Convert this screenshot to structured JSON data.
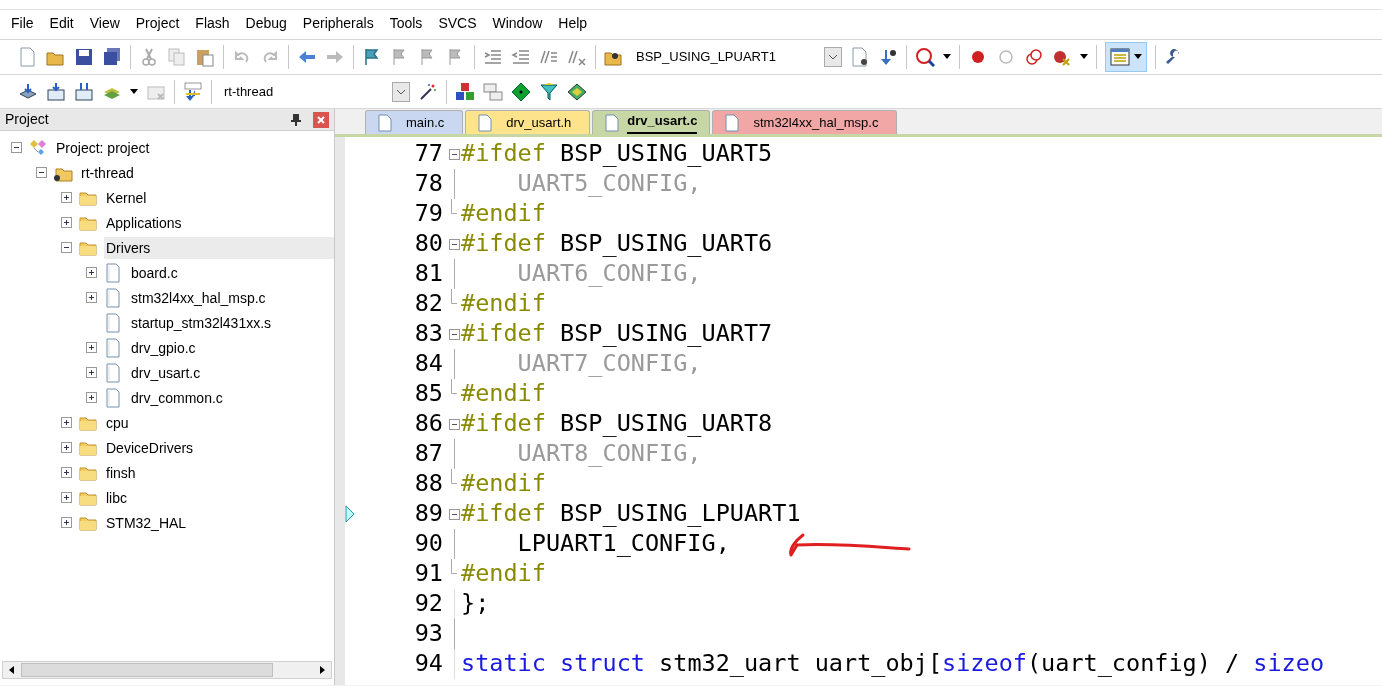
{
  "menu": [
    "File",
    "Edit",
    "View",
    "Project",
    "Flash",
    "Debug",
    "Peripherals",
    "Tools",
    "SVCS",
    "Window",
    "Help"
  ],
  "toolbar": {
    "define_combo": "BSP_USING_LPUART1",
    "layout_button_on": true
  },
  "build_toolbar": {
    "target_combo": "rt-thread"
  },
  "project_panel": {
    "title": "Project",
    "tree": [
      {
        "label": "Project: project",
        "kind": "project",
        "expanded": true,
        "selected": false,
        "children": [
          {
            "label": "rt-thread",
            "kind": "target",
            "expanded": true,
            "selected": false,
            "children": [
              {
                "label": "Kernel",
                "kind": "folder",
                "expanded": false,
                "selected": false
              },
              {
                "label": "Applications",
                "kind": "folder",
                "expanded": false,
                "selected": false
              },
              {
                "label": "Drivers",
                "kind": "folder",
                "expanded": true,
                "selected": true,
                "children": [
                  {
                    "label": "board.c",
                    "kind": "file",
                    "expandable": true,
                    "selected": false
                  },
                  {
                    "label": "stm32l4xx_hal_msp.c",
                    "kind": "file",
                    "expandable": true,
                    "selected": false
                  },
                  {
                    "label": "startup_stm32l431xx.s",
                    "kind": "file",
                    "expandable": false,
                    "selected": false
                  },
                  {
                    "label": "drv_gpio.c",
                    "kind": "file",
                    "expandable": true,
                    "selected": false
                  },
                  {
                    "label": "drv_usart.c",
                    "kind": "file",
                    "expandable": true,
                    "selected": false
                  },
                  {
                    "label": "drv_common.c",
                    "kind": "file",
                    "expandable": true,
                    "selected": false
                  }
                ]
              },
              {
                "label": "cpu",
                "kind": "folder",
                "expanded": false,
                "selected": false
              },
              {
                "label": "DeviceDrivers",
                "kind": "folder",
                "expanded": false,
                "selected": false
              },
              {
                "label": "finsh",
                "kind": "folder",
                "expanded": false,
                "selected": false
              },
              {
                "label": "libc",
                "kind": "folder",
                "expanded": false,
                "selected": false
              },
              {
                "label": "STM32_HAL",
                "kind": "folder",
                "expanded": false,
                "selected": false
              }
            ]
          }
        ]
      }
    ]
  },
  "tabs": [
    {
      "label": "main.c",
      "color": "#c9d8f0",
      "selected": false
    },
    {
      "label": "drv_usart.h",
      "color": "#fde48c",
      "selected": false
    },
    {
      "label": "drv_usart.c",
      "color": "#c6d6a4",
      "selected": true
    },
    {
      "label": "stm32l4xx_hal_msp.c",
      "color": "#f2a7a7",
      "selected": false
    }
  ],
  "editor": {
    "lines": [
      {
        "number": "77",
        "kind": "fold_start",
        "current": false,
        "tokens": [
          {
            "text": "#ifdef",
            "kind": "preproc"
          },
          {
            "text": " BSP_USING_UART5",
            "kind": "plain"
          }
        ]
      },
      {
        "number": "78",
        "kind": "fold_body",
        "current": false,
        "tokens": [
          {
            "text": "    UART5_CONFIG,",
            "kind": "inactive"
          }
        ]
      },
      {
        "number": "79",
        "kind": "fold_end",
        "current": false,
        "tokens": [
          {
            "text": "#endif",
            "kind": "preproc"
          }
        ]
      },
      {
        "number": "80",
        "kind": "fold_start",
        "current": false,
        "tokens": [
          {
            "text": "#ifdef",
            "kind": "preproc"
          },
          {
            "text": " BSP_USING_UART6",
            "kind": "plain"
          }
        ]
      },
      {
        "number": "81",
        "kind": "fold_body",
        "current": false,
        "tokens": [
          {
            "text": "    UART6_CONFIG,",
            "kind": "inactive"
          }
        ]
      },
      {
        "number": "82",
        "kind": "fold_end",
        "current": false,
        "tokens": [
          {
            "text": "#endif",
            "kind": "preproc"
          }
        ]
      },
      {
        "number": "83",
        "kind": "fold_start",
        "current": false,
        "tokens": [
          {
            "text": "#ifdef",
            "kind": "preproc"
          },
          {
            "text": " BSP_USING_UART7",
            "kind": "plain"
          }
        ]
      },
      {
        "number": "84",
        "kind": "fold_body",
        "current": false,
        "tokens": [
          {
            "text": "    UART7_CONFIG,",
            "kind": "inactive"
          }
        ]
      },
      {
        "number": "85",
        "kind": "fold_end",
        "current": false,
        "tokens": [
          {
            "text": "#endif",
            "kind": "preproc"
          }
        ]
      },
      {
        "number": "86",
        "kind": "fold_start",
        "current": false,
        "tokens": [
          {
            "text": "#ifdef",
            "kind": "preproc"
          },
          {
            "text": " BSP_USING_UART8",
            "kind": "plain"
          }
        ]
      },
      {
        "number": "87",
        "kind": "fold_body",
        "current": false,
        "tokens": [
          {
            "text": "    UART8_CONFIG,",
            "kind": "inactive"
          }
        ]
      },
      {
        "number": "88",
        "kind": "fold_end",
        "current": false,
        "tokens": [
          {
            "text": "#endif",
            "kind": "preproc"
          }
        ]
      },
      {
        "number": "89",
        "kind": "fold_start",
        "current": true,
        "tokens": [
          {
            "text": "#ifdef",
            "kind": "preproc"
          },
          {
            "text": " BSP_USING_LPUART1",
            "kind": "plain"
          }
        ]
      },
      {
        "number": "90",
        "kind": "fold_body",
        "current": false,
        "tokens": [
          {
            "text": "    LPUART1_CONFIG,",
            "kind": "plain"
          }
        ]
      },
      {
        "number": "91",
        "kind": "fold_end",
        "current": false,
        "tokens": [
          {
            "text": "#endif",
            "kind": "preproc"
          }
        ]
      },
      {
        "number": "92",
        "kind": "plain",
        "current": false,
        "tokens": [
          {
            "text": "};",
            "kind": "plain"
          }
        ]
      },
      {
        "number": "93",
        "kind": "fold_body",
        "current": false
      },
      {
        "number": "94",
        "kind": "plain",
        "current": false,
        "tokens": [
          {
            "text": "static",
            "kind": "keyword"
          },
          {
            "text": " struct",
            "kind": "keyword"
          },
          {
            "text": " stm32_uart uart_obj[",
            "kind": "plain"
          },
          {
            "text": "sizeof",
            "kind": "keyword"
          },
          {
            "text": "(uart_config) / ",
            "kind": "plain"
          },
          {
            "text": "sizeo",
            "kind": "keyword"
          }
        ]
      }
    ]
  }
}
